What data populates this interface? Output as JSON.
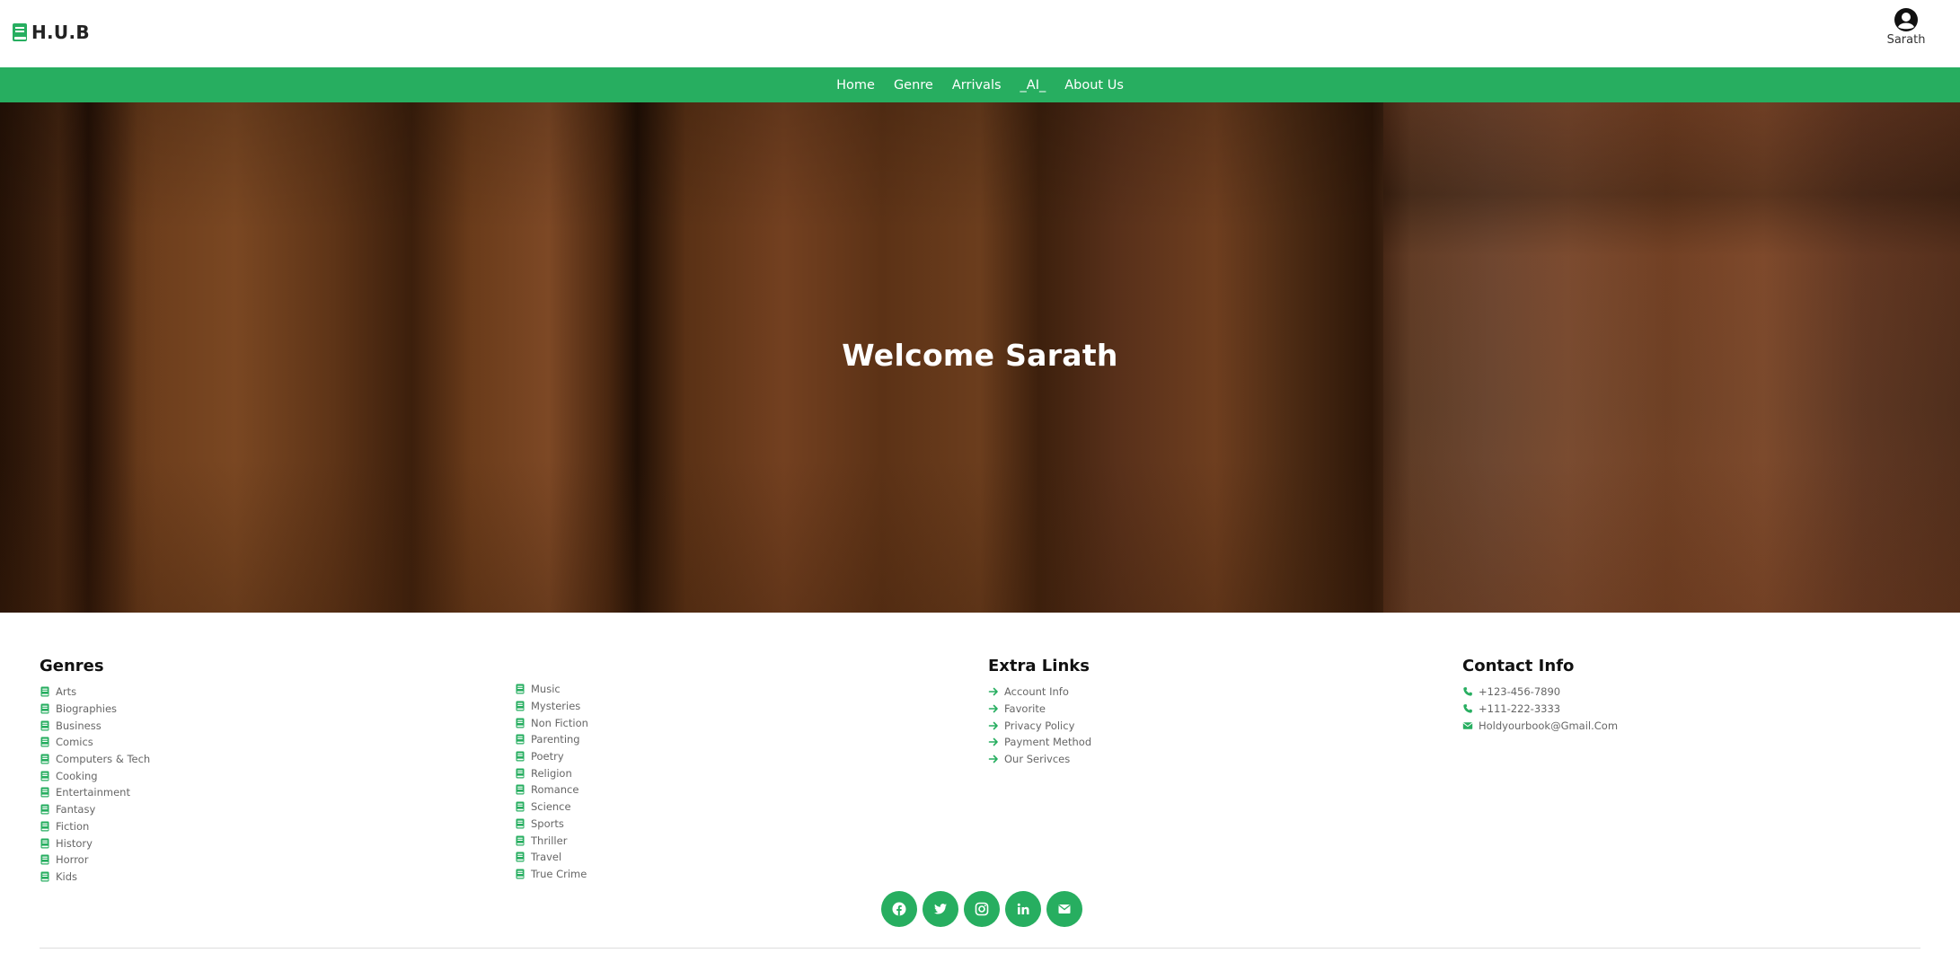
{
  "brand": {
    "name": "H.U.B"
  },
  "user": {
    "name": "Sarath"
  },
  "nav": {
    "items": [
      {
        "label": "Home"
      },
      {
        "label": "Genre"
      },
      {
        "label": "Arrivals"
      },
      {
        "label": "_AI_"
      },
      {
        "label": "About Us"
      }
    ]
  },
  "hero": {
    "title": "Welcome Sarath"
  },
  "footer": {
    "genres": {
      "heading": "Genres",
      "col1": [
        "Arts",
        "Biographies",
        "Business",
        "Comics",
        "Computers & Tech",
        "Cooking",
        "Entertainment",
        "Fantasy",
        "Fiction",
        "History",
        "Horror",
        "Kids"
      ],
      "col2": [
        "Music",
        "Mysteries",
        "Non Fiction",
        "Parenting",
        "Poetry",
        "Religion",
        "Romance",
        "Science",
        "Sports",
        "Thriller",
        "Travel",
        "True Crime"
      ]
    },
    "extra_links": {
      "heading": "Extra Links",
      "items": [
        "Account Info",
        "Favorite",
        "Privacy Policy",
        "Payment Method",
        "Our Serivces"
      ]
    },
    "contact": {
      "heading": "Contact Info",
      "items": [
        {
          "icon": "phone-icon",
          "text": "+123-456-7890"
        },
        {
          "icon": "phone-icon",
          "text": "+111-222-3333"
        },
        {
          "icon": "envelope-icon",
          "text": "Holdyourbook@Gmail.Com"
        }
      ]
    },
    "socials": [
      "facebook-icon",
      "twitter-icon",
      "instagram-icon",
      "linkedin-icon",
      "envelope-icon"
    ]
  },
  "colors": {
    "accent": "#27ae60",
    "text": "#333333",
    "muted": "#666666"
  }
}
